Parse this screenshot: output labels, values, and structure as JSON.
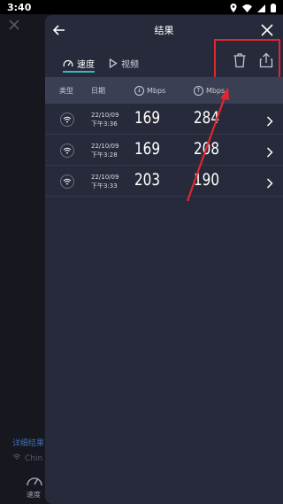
{
  "status_bar": {
    "time": "3:40"
  },
  "background": {
    "detail_link": "详细结果",
    "wifi_name": "Chin",
    "nav_speed_label": "速度"
  },
  "header": {
    "title": "结果"
  },
  "tabs": [
    {
      "label": "速度",
      "selected": true
    },
    {
      "label": "视频",
      "selected": false
    }
  ],
  "table": {
    "headers": {
      "type": "类型",
      "date": "日期",
      "download": "Mbps",
      "upload": "Mbps"
    },
    "rows": [
      {
        "date": "22/10/09",
        "time": "下午3:36",
        "download": "169",
        "upload": "284"
      },
      {
        "date": "22/10/09",
        "time": "下午3:28",
        "download": "169",
        "upload": "208"
      },
      {
        "date": "22/10/09",
        "time": "下午3:33",
        "download": "203",
        "upload": "190"
      }
    ]
  },
  "colors": {
    "panel": "#272a3a",
    "accent": "#35b9c5",
    "annotation": "#e0272f"
  }
}
